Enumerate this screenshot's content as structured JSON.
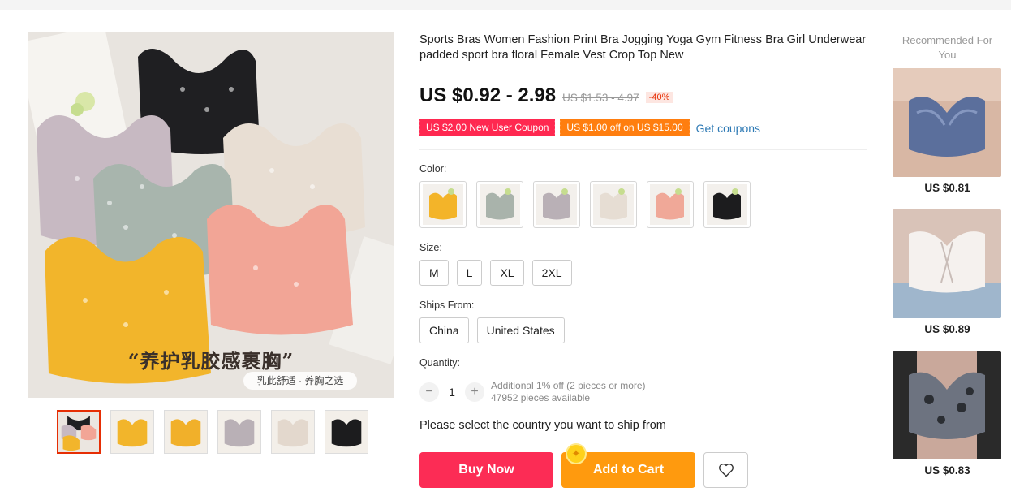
{
  "product": {
    "title": "Sports Bras Women Fashion Print Bra Jogging Yoga Gym Fitness Bra Girl Underwear padded sport bra floral Female Vest Crop Top New",
    "price": "US $0.92 - 2.98",
    "old_price": "US $1.53 - 4.97",
    "discount": "-40%",
    "main_image_caption": "“养护乳胶感裹胸”",
    "main_image_subcaption": "乳此舒适 · 养胸之选"
  },
  "coupons": {
    "new_user": "US $2.00 New User Coupon",
    "store": "US $1.00 off on US $15.00",
    "get_link": "Get coupons"
  },
  "color": {
    "label": "Color:",
    "swatches": [
      {
        "name": "yellow",
        "color": "#f3b429"
      },
      {
        "name": "gray-green",
        "color": "#a9b3ab"
      },
      {
        "name": "lavender-gray",
        "color": "#b9b0b6"
      },
      {
        "name": "beige",
        "color": "#e6ddd3"
      },
      {
        "name": "pink",
        "color": "#f0a898"
      },
      {
        "name": "black",
        "color": "#1c1c1e"
      }
    ]
  },
  "size": {
    "label": "Size:",
    "options": [
      "M",
      "L",
      "XL",
      "2XL"
    ]
  },
  "ships_from": {
    "label": "Ships From:",
    "options": [
      "China",
      "United States"
    ]
  },
  "quantity": {
    "label": "Quantity:",
    "minus": "−",
    "plus": "+",
    "value": "1",
    "discount_note": "Additional 1% off (2 pieces or more)",
    "available": "47952 pieces available"
  },
  "ship_message": "Please select the country you want to ship from",
  "actions": {
    "buy_now": "Buy Now",
    "add_to_cart": "Add to Cart"
  },
  "recommended": {
    "title": "Recommended For You",
    "items": [
      {
        "price": "US $0.81"
      },
      {
        "price": "US $0.89"
      },
      {
        "price": "US $0.83"
      }
    ]
  },
  "colors": {
    "accent_red": "#fc2c55",
    "accent_orange": "#ff9a0e",
    "link_blue": "#2e7ab5"
  }
}
